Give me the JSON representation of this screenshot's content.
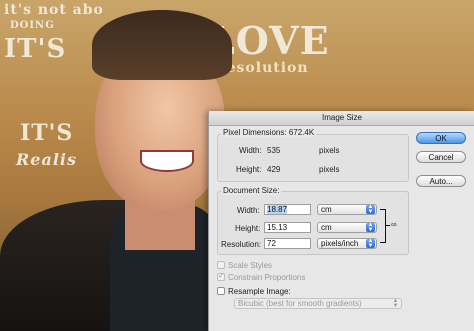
{
  "photo": {
    "poster_texts": [
      "it's not abo",
      "DOING",
      "IT'S",
      "LOVE",
      "Resolution",
      "IT'S",
      "Realis"
    ]
  },
  "dialog": {
    "title": "Image Size",
    "pixel_dimensions": {
      "title": "Pixel Dimensions:",
      "size": "672.4K",
      "width_label": "Width:",
      "width_value": "535",
      "width_unit": "pixels",
      "height_label": "Height:",
      "height_value": "429",
      "height_unit": "pixels"
    },
    "document_size": {
      "title": "Document Size:",
      "width_label": "Width:",
      "width_value": "18.87",
      "width_unit": "cm",
      "height_label": "Height:",
      "height_value": "15.13",
      "height_unit": "cm",
      "resolution_label": "Resolution:",
      "resolution_value": "72",
      "resolution_unit": "pixels/inch"
    },
    "options": {
      "scale_styles": {
        "label": "Scale Styles",
        "checked": false
      },
      "constrain_proportions": {
        "label": "Constrain Proportions",
        "checked": true
      },
      "resample_image": {
        "label": "Resample Image:",
        "checked": false
      },
      "resample_method": "Bicubic (best for smooth gradients)"
    },
    "buttons": {
      "ok": "OK",
      "cancel": "Cancel",
      "auto": "Auto..."
    }
  },
  "colors": {
    "ok_button": "#4b97ea",
    "select_arrows": "#2a6dd6",
    "dialog_bg": "#e7e7e7"
  }
}
